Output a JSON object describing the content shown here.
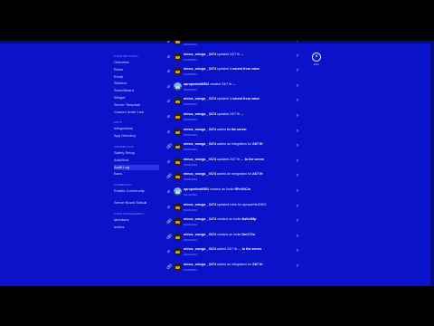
{
  "sidebar": {
    "sections": [
      {
        "label": "User Settings",
        "items": [
          {
            "label": "Overview"
          },
          {
            "label": "Roles"
          },
          {
            "label": "Emoji"
          },
          {
            "label": "Stickers"
          },
          {
            "label": "Soundboard"
          },
          {
            "label": "Widget"
          },
          {
            "label": "Server Template"
          },
          {
            "label": "Custom Invite Link"
          }
        ]
      },
      {
        "label": "Apps",
        "items": [
          {
            "label": "Integrations"
          },
          {
            "label": "App Directory"
          }
        ]
      },
      {
        "label": "Moderation",
        "items": [
          {
            "label": "Safety Setup"
          },
          {
            "label": "AutoMod"
          },
          {
            "label": "Audit Log"
          },
          {
            "label": "Bans"
          }
        ]
      },
      {
        "label": "Community",
        "items": [
          {
            "label": "Enable Community"
          }
        ]
      },
      {
        "label": "",
        "items": [
          {
            "label": "Server Boost Status",
            "num": "4"
          }
        ]
      },
      {
        "label": "User Management",
        "items": [
          {
            "label": "Members"
          },
          {
            "label": "Invites"
          }
        ]
      }
    ]
  },
  "audit": [
    {
      "icon": "♬",
      "msg": "minus_omega__0474 ",
      "action": "updated the sound",
      "tail": "",
      "ts": "03/26/2024"
    },
    {
      "icon": "♬",
      "msg": "minus_omega__0474 ",
      "action": "updated 24/7 lfr — ",
      "tail": "",
      "ts": "03/26/2024"
    },
    {
      "icon": "♬",
      "msg": "minus_omega__0474 ",
      "action": "updated ",
      "tail": "1 sound from voice",
      "ts": "03/26/2024"
    },
    {
      "icon": "♬",
      "msg": "aproperbird0502 ",
      "action": "created 24/7 lfr — ",
      "tail": "",
      "ts": "03/26/2024",
      "sky": true
    },
    {
      "icon": "♬",
      "msg": "minus_omega__0474 ",
      "action": "updated ",
      "tail": "1 sound from voice",
      "ts": "03/26/2024"
    },
    {
      "icon": "♬",
      "msg": "minus_omega__0474 ",
      "action": "updated 24/7 lfr — ",
      "tail": "",
      "ts": "03/26/2024"
    },
    {
      "icon": "♬",
      "msg": "minus_omega__0474 ",
      "action": "added ",
      "tail": "to the server",
      "ts": "03/26/2024"
    },
    {
      "icon": "🔗",
      "msg": "minus_omega__0474 ",
      "action": "added an integration for ",
      "tail": "24/7 lfr",
      "ts": "03/26/2024"
    },
    {
      "icon": "♬",
      "msg": "minus_omega__0474 ",
      "action": "updated 24/7 lfr — ",
      "tail": "to the server",
      "ts": "03/26/2024"
    },
    {
      "icon": "🔗",
      "msg": "minus_omega__0474 ",
      "action": "added an integration for ",
      "tail": "24/7 lfr",
      "ts": "03/26/2024"
    },
    {
      "icon": "♬",
      "msg": "aproperbird0502 ",
      "action": "created an invite ",
      "tail": "RPnVtXJn",
      "ts": "03/26/2024",
      "sky": true
    },
    {
      "icon": "♬",
      "msg": "minus_omega__0474 ",
      "action": "updated roles for aproperbird0502",
      "tail": "",
      "ts": "03/26/2024"
    },
    {
      "icon": "🔗",
      "msg": "minus_omega__0474 ",
      "action": "created an invite ",
      "tail": "8wKzD8p",
      "ts": "03/26/2024"
    },
    {
      "icon": "🔗",
      "msg": "minus_omega__0474 ",
      "action": "created an invite ",
      "tail": "Dm17Xu",
      "ts": "03/26/2024"
    },
    {
      "icon": "♬",
      "msg": "minus_omega__0474 ",
      "action": "added 24/7 lfr — ",
      "tail": "to the server",
      "ts": "03/26/2024"
    },
    {
      "icon": "🔗",
      "msg": "minus_omega__0474 ",
      "action": "added an integration for ",
      "tail": "24/7 lfr",
      "ts": "03/26/2024"
    }
  ],
  "close": {
    "icon": "×",
    "label": "ESC"
  }
}
